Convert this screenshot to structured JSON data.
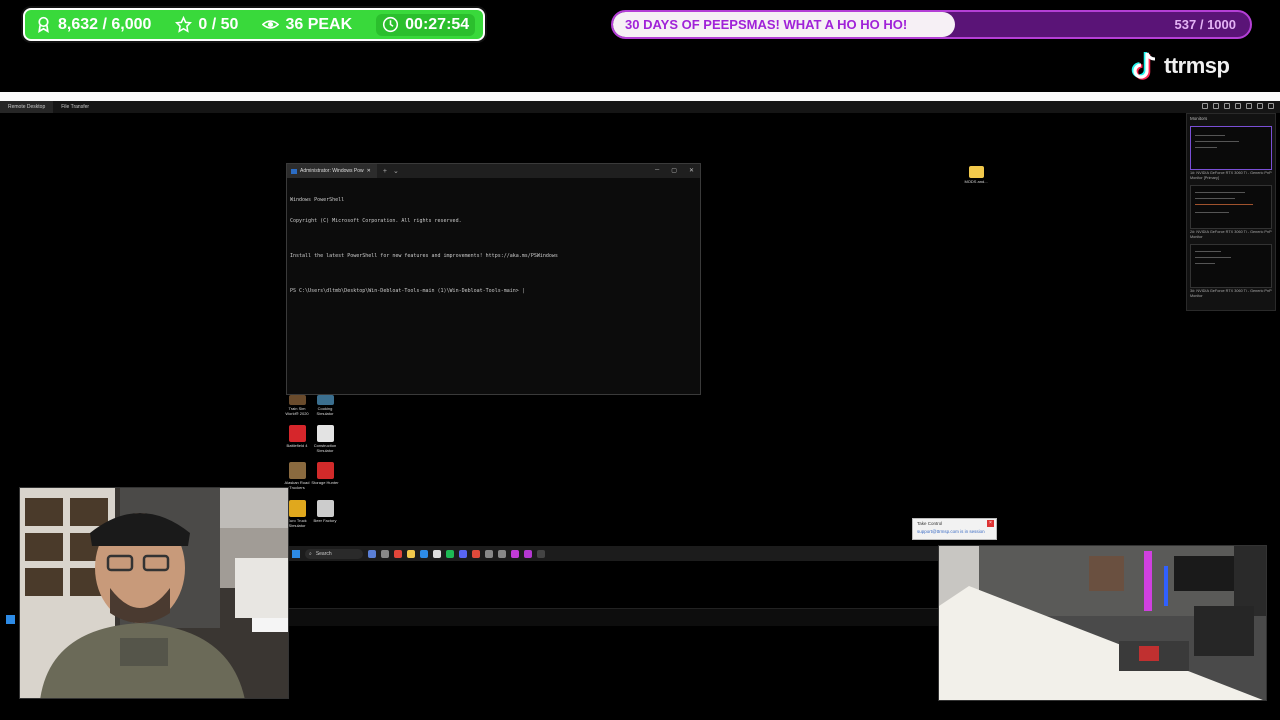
{
  "overlay": {
    "followers": "8,632 / 6,000",
    "subs": "0 / 50",
    "viewers_peak": "36 PEAK",
    "timer": "00:27:54",
    "colors": {
      "stats_bg": "#39d93b",
      "goal_border": "#b43fd6",
      "goal_text": "#a022d8"
    }
  },
  "goal": {
    "title": "30 DAYS OF PEEPSMAS! WHAT A HO HO HO!",
    "count": "537 / 1000",
    "progress": 0.537
  },
  "tiktok": {
    "handle": "ttrmsp"
  },
  "remote_desktop": {
    "tabs": [
      "Remote Desktop",
      "File Transfer"
    ],
    "monitors_panel": {
      "header": "Monitors",
      "items": [
        "1#: NVIDIA GeForce RTX 3060 Ti - Generic PnP Monitor [Primary]",
        "2#: NVIDIA GeForce RTX 3060 Ti - Generic PnP Monitor",
        "3#: NVIDIA GeForce RTX 3060 Ti - Generic PnP Monitor"
      ]
    }
  },
  "powershell": {
    "tab_title": "Administrator: Windows Pow",
    "lines": [
      "Windows PowerShell",
      "Copyright (C) Microsoft Corporation. All rights reserved.",
      "",
      "Install the latest PowerShell for new features and improvements! https://aka.ms/PSWindows",
      "",
      "PS C:\\Users\\dltmb\\Desktop\\Win-Debloat-Tools-main (1)\\Win-Debloat-Tools-main> |"
    ]
  },
  "desktop_icons": [
    {
      "label": "Train Sim World® 2020",
      "color": "#6a4b2c"
    },
    {
      "label": "Cooking Simulator",
      "color": "#3b6f8f"
    },
    {
      "label": "Battlefield 4",
      "color": "#d6262b"
    },
    {
      "label": "Construction Simulator",
      "color": "#e3e3e3"
    },
    {
      "label": "Alaskan Road Truckers",
      "color": "#8a6a3f"
    },
    {
      "label": "Storage Hunter",
      "color": "#d12a2a"
    },
    {
      "label": "Euro Truck Simulator",
      "color": "#e0a81d"
    },
    {
      "label": "Beer Factory",
      "color": "#cccccc"
    }
  ],
  "folder_icon": {
    "label": "MODS and..."
  },
  "taskbar": {
    "search_label": "Search"
  },
  "notification": {
    "title": "Take Control",
    "subtitle": "support@ttrmsp.com is in session"
  }
}
